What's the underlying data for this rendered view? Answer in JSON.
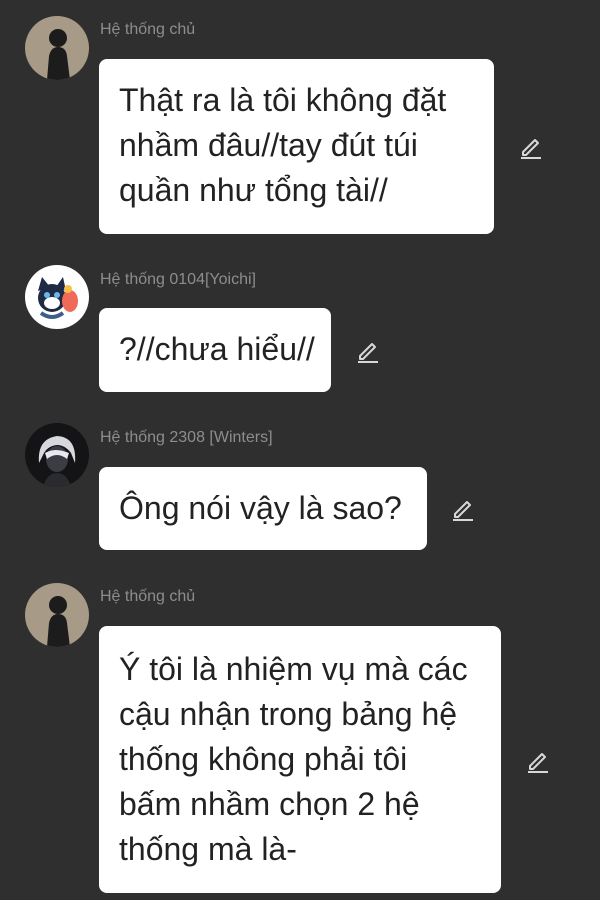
{
  "colors": {
    "background": "#2f2f2f",
    "bubble": "#ffffff",
    "text": "#222222",
    "sender": "#8d8d8d",
    "icon": "#d8d8d8"
  },
  "messages": [
    {
      "avatar": "dark-silhouette-avatar",
      "sender": "Hệ thống chủ",
      "lines": [
        "Thật ra là tôi không đặt",
        "nhầm đâu//tay đút túi",
        "quần như tổng tài//"
      ],
      "edit_icon": "pencil-icon"
    },
    {
      "avatar": "cartoon-cat-avatar",
      "sender": "Hệ thống 0104[Yoichi]",
      "lines": [
        "?//chưa hiểu//"
      ],
      "edit_icon": "pencil-icon"
    },
    {
      "avatar": "white-haired-anime-avatar",
      "sender": "Hệ thống 2308 [Winters]",
      "lines": [
        "Ông nói vậy là sao?"
      ],
      "edit_icon": "pencil-icon"
    },
    {
      "avatar": "dark-silhouette-avatar",
      "sender": "Hệ thống chủ",
      "lines": [
        "Ý tôi là nhiệm vụ mà các",
        "cậu nhận trong bảng hệ",
        "thống không phải tôi",
        "bấm nhầm chọn 2 hệ",
        "thống mà là-"
      ],
      "edit_icon": "pencil-icon"
    }
  ]
}
